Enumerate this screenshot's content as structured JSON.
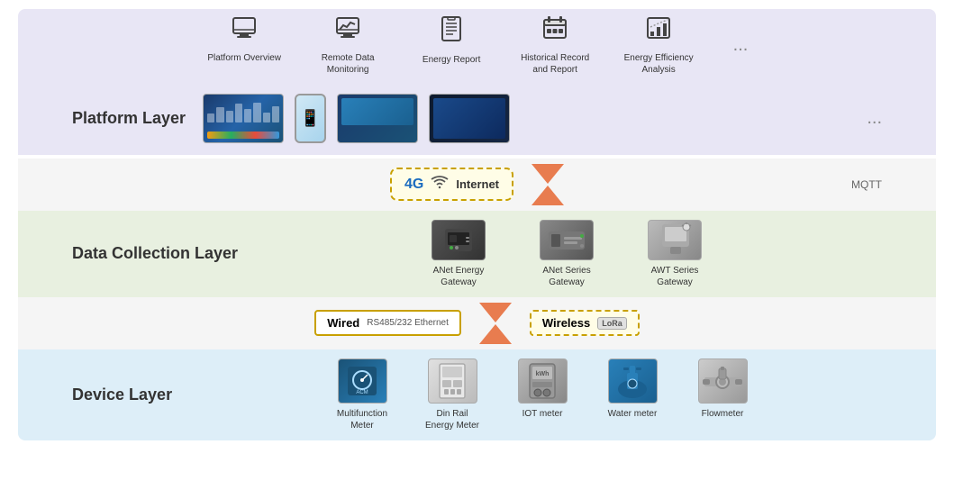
{
  "top_icons": [
    {
      "id": "platform-overview",
      "label": "Platform\nOverview",
      "symbol": "🖥"
    },
    {
      "id": "remote-data-monitoring",
      "label": "Remote Data\nMonitoring",
      "symbol": "📈"
    },
    {
      "id": "energy-report",
      "label": "Energy Report",
      "symbol": "📋"
    },
    {
      "id": "historical-record",
      "label": "Historical Record\nand Report",
      "symbol": "📊"
    },
    {
      "id": "energy-efficiency",
      "label": "Energy Efficiency\nAnalysis",
      "symbol": "📉"
    }
  ],
  "more_label": "...",
  "layers": {
    "platform": {
      "label": "Platform Layer",
      "screens": [
        "dashboard",
        "phone",
        "laptop",
        "dark"
      ]
    },
    "connection": {
      "signal": "4G",
      "internet_label": "Internet",
      "protocol": "MQTT"
    },
    "collection": {
      "label": "Data Collection Layer",
      "devices": [
        {
          "id": "anet-energy",
          "label": "ANet Energy Gateway"
        },
        {
          "id": "anet-series",
          "label": "ANet Series Gateway"
        },
        {
          "id": "awt-series",
          "label": "AWT Series Gateway"
        }
      ]
    },
    "wired_wireless": {
      "wired_label": "Wired",
      "wired_sub": "RS485/232    Ethernet",
      "wireless_label": "Wireless",
      "wireless_sub": "LoRa"
    },
    "device": {
      "label": "Device Layer",
      "devices": [
        {
          "id": "multifunction-meter",
          "label": "Multifunction\nMeter"
        },
        {
          "id": "din-rail-energy-meter",
          "label": "Din Rail\nEnergy Meter"
        },
        {
          "id": "iot-meter",
          "label": "IOT meter"
        },
        {
          "id": "water-meter",
          "label": "Water meter"
        },
        {
          "id": "flowmeter",
          "label": "Flowmeter"
        }
      ]
    }
  }
}
